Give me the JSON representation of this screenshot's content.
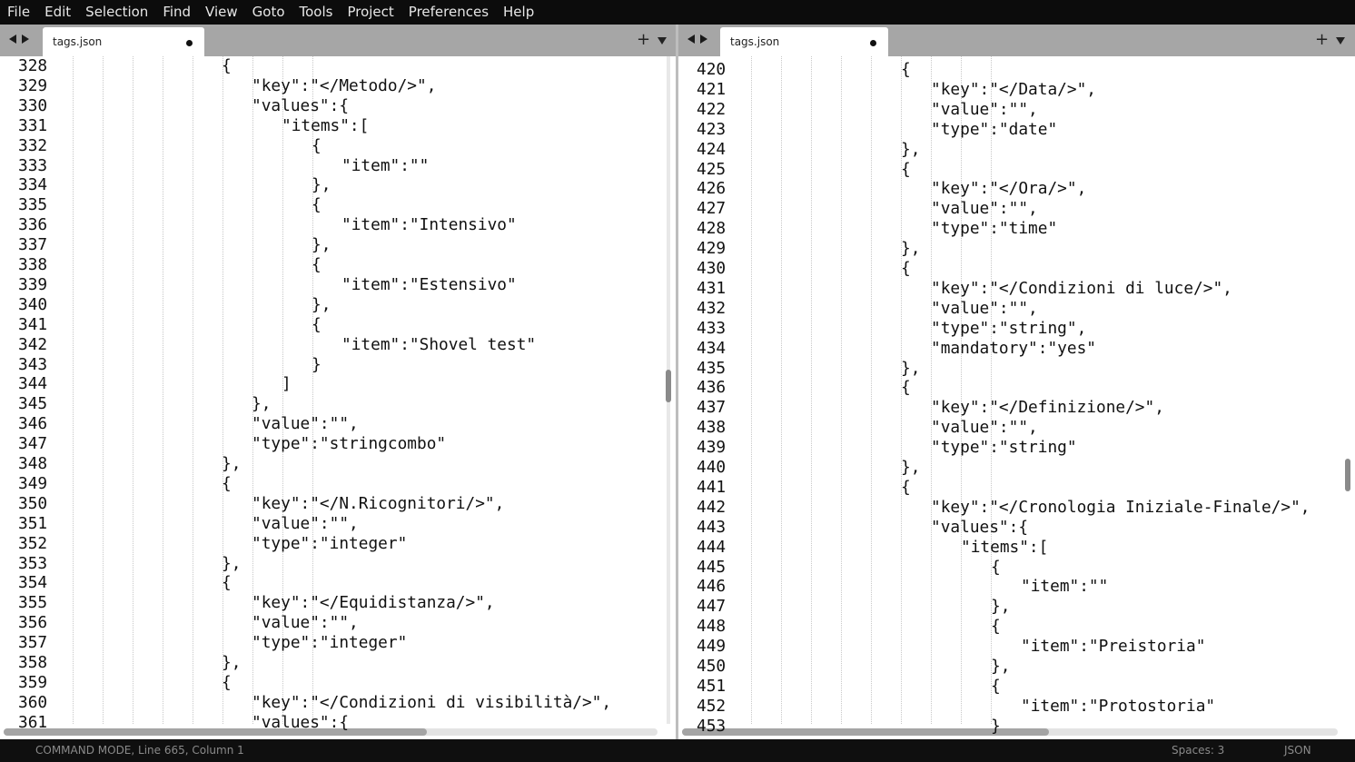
{
  "menu": [
    "File",
    "Edit",
    "Selection",
    "Find",
    "View",
    "Goto",
    "Tools",
    "Project",
    "Preferences",
    "Help"
  ],
  "left_pane": {
    "tab_label": "tags.json",
    "lines": [
      {
        "n": "328",
        "indent": 6,
        "text": "{"
      },
      {
        "n": "329",
        "indent": 7,
        "text": "\"key\":\"</Metodo/>\","
      },
      {
        "n": "330",
        "indent": 7,
        "text": "\"values\":{"
      },
      {
        "n": "331",
        "indent": 8,
        "text": "\"items\":["
      },
      {
        "n": "332",
        "indent": 9,
        "text": "{"
      },
      {
        "n": "333",
        "indent": 10,
        "text": "\"item\":\"\""
      },
      {
        "n": "334",
        "indent": 9,
        "text": "},"
      },
      {
        "n": "335",
        "indent": 9,
        "text": "{"
      },
      {
        "n": "336",
        "indent": 10,
        "text": "\"item\":\"Intensivo\""
      },
      {
        "n": "337",
        "indent": 9,
        "text": "},"
      },
      {
        "n": "338",
        "indent": 9,
        "text": "{"
      },
      {
        "n": "339",
        "indent": 10,
        "text": "\"item\":\"Estensivo\""
      },
      {
        "n": "340",
        "indent": 9,
        "text": "},"
      },
      {
        "n": "341",
        "indent": 9,
        "text": "{"
      },
      {
        "n": "342",
        "indent": 10,
        "text": "\"item\":\"Shovel test\""
      },
      {
        "n": "343",
        "indent": 9,
        "text": "}"
      },
      {
        "n": "344",
        "indent": 8,
        "text": "]"
      },
      {
        "n": "345",
        "indent": 7,
        "text": "},"
      },
      {
        "n": "346",
        "indent": 7,
        "text": "\"value\":\"\","
      },
      {
        "n": "347",
        "indent": 7,
        "text": "\"type\":\"stringcombo\""
      },
      {
        "n": "348",
        "indent": 6,
        "text": "},"
      },
      {
        "n": "349",
        "indent": 6,
        "text": "{"
      },
      {
        "n": "350",
        "indent": 7,
        "text": "\"key\":\"</N.Ricognitori/>\","
      },
      {
        "n": "351",
        "indent": 7,
        "text": "\"value\":\"\","
      },
      {
        "n": "352",
        "indent": 7,
        "text": "\"type\":\"integer\""
      },
      {
        "n": "353",
        "indent": 6,
        "text": "},"
      },
      {
        "n": "354",
        "indent": 6,
        "text": "{"
      },
      {
        "n": "355",
        "indent": 7,
        "text": "\"key\":\"</Equidistanza/>\","
      },
      {
        "n": "356",
        "indent": 7,
        "text": "\"value\":\"\","
      },
      {
        "n": "357",
        "indent": 7,
        "text": "\"type\":\"integer\""
      },
      {
        "n": "358",
        "indent": 6,
        "text": "},"
      },
      {
        "n": "359",
        "indent": 6,
        "text": "{"
      },
      {
        "n": "360",
        "indent": 7,
        "text": "\"key\":\"</Condizioni di visibilità/>\","
      },
      {
        "n": "361",
        "indent": 7,
        "text": "\"values\":{"
      }
    ]
  },
  "right_pane": {
    "tab_label": "tags.json",
    "lines": [
      {
        "n": "420",
        "indent": 6,
        "text": "{"
      },
      {
        "n": "421",
        "indent": 7,
        "text": "\"key\":\"</Data/>\","
      },
      {
        "n": "422",
        "indent": 7,
        "text": "\"value\":\"\","
      },
      {
        "n": "423",
        "indent": 7,
        "text": "\"type\":\"date\""
      },
      {
        "n": "424",
        "indent": 6,
        "text": "},"
      },
      {
        "n": "425",
        "indent": 6,
        "text": "{"
      },
      {
        "n": "426",
        "indent": 7,
        "text": "\"key\":\"</Ora/>\","
      },
      {
        "n": "427",
        "indent": 7,
        "text": "\"value\":\"\","
      },
      {
        "n": "428",
        "indent": 7,
        "text": "\"type\":\"time\""
      },
      {
        "n": "429",
        "indent": 6,
        "text": "},"
      },
      {
        "n": "430",
        "indent": 6,
        "text": "{"
      },
      {
        "n": "431",
        "indent": 7,
        "text": "\"key\":\"</Condizioni di luce/>\","
      },
      {
        "n": "432",
        "indent": 7,
        "text": "\"value\":\"\","
      },
      {
        "n": "433",
        "indent": 7,
        "text": "\"type\":\"string\","
      },
      {
        "n": "434",
        "indent": 7,
        "text": "\"mandatory\":\"yes\""
      },
      {
        "n": "435",
        "indent": 6,
        "text": "},"
      },
      {
        "n": "436",
        "indent": 6,
        "text": "{"
      },
      {
        "n": "437",
        "indent": 7,
        "text": "\"key\":\"</Definizione/>\","
      },
      {
        "n": "438",
        "indent": 7,
        "text": "\"value\":\"\","
      },
      {
        "n": "439",
        "indent": 7,
        "text": "\"type\":\"string\""
      },
      {
        "n": "440",
        "indent": 6,
        "text": "},"
      },
      {
        "n": "441",
        "indent": 6,
        "text": "{"
      },
      {
        "n": "442",
        "indent": 7,
        "text": "\"key\":\"</Cronologia Iniziale-Finale/>\","
      },
      {
        "n": "443",
        "indent": 7,
        "text": "\"values\":{"
      },
      {
        "n": "444",
        "indent": 8,
        "text": "\"items\":["
      },
      {
        "n": "445",
        "indent": 9,
        "text": "{"
      },
      {
        "n": "446",
        "indent": 10,
        "text": "\"item\":\"\""
      },
      {
        "n": "447",
        "indent": 9,
        "text": "},"
      },
      {
        "n": "448",
        "indent": 9,
        "text": "{"
      },
      {
        "n": "449",
        "indent": 10,
        "text": "\"item\":\"Preistoria\""
      },
      {
        "n": "450",
        "indent": 9,
        "text": "},"
      },
      {
        "n": "451",
        "indent": 9,
        "text": "{"
      },
      {
        "n": "452",
        "indent": 10,
        "text": "\"item\":\"Protostoria\""
      },
      {
        "n": "453",
        "indent": 9,
        "text": "}"
      }
    ]
  },
  "status": {
    "left": "COMMAND MODE, Line 665, Column 1",
    "spaces": "Spaces: 3",
    "syntax": "JSON"
  }
}
